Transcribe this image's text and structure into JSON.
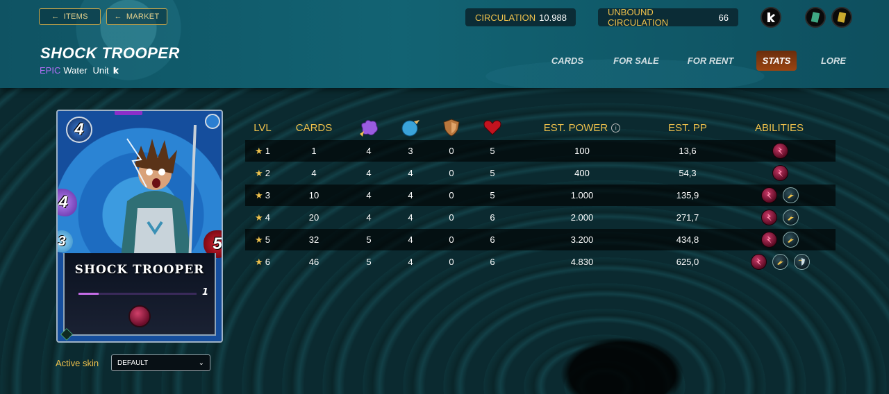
{
  "nav": {
    "items_label": "ITEMS",
    "market_label": "MARKET"
  },
  "stats_bar": {
    "circulation_label": "CIRCULATION",
    "circulation_value": "10.988",
    "unbound_label": "UNBOUND CIRCULATION",
    "unbound_value": "66"
  },
  "card_header": {
    "name": "SHOCK TROOPER",
    "rarity": "EPIC",
    "element": "Water",
    "type": "Unit"
  },
  "tabs": [
    {
      "label": "CARDS",
      "active": false
    },
    {
      "label": "FOR SALE",
      "active": false
    },
    {
      "label": "FOR RENT",
      "active": false
    },
    {
      "label": "STATS",
      "active": true
    },
    {
      "label": "LORE",
      "active": false
    }
  ],
  "card_art": {
    "mana": "4",
    "magic": "4",
    "speed": "3",
    "health": "5",
    "name": "SHOCK TROOPER",
    "level": "1",
    "level_progress": 0.17
  },
  "skin": {
    "label": "Active skin",
    "selected": "DEFAULT"
  },
  "table": {
    "headers": {
      "lvl": "LVL",
      "cards": "CARDS",
      "est_power": "EST. POWER",
      "est_pp": "EST. PP",
      "abilities": "ABILITIES"
    },
    "rows": [
      {
        "lvl": "1",
        "cards": "1",
        "magic": "4",
        "speed": "3",
        "armor": "0",
        "health": "5",
        "power": "100",
        "pp": "13,6",
        "abilities": [
          "shock-icon"
        ]
      },
      {
        "lvl": "2",
        "cards": "4",
        "magic": "4",
        "speed": "4",
        "armor": "0",
        "health": "5",
        "power": "400",
        "pp": "54,3",
        "abilities": [
          "shock-icon"
        ]
      },
      {
        "lvl": "3",
        "cards": "10",
        "magic": "4",
        "speed": "4",
        "armor": "0",
        "health": "5",
        "power": "1.000",
        "pp": "135,9",
        "abilities": [
          "shock-icon",
          "swiftness-icon"
        ]
      },
      {
        "lvl": "4",
        "cards": "20",
        "magic": "4",
        "speed": "4",
        "armor": "0",
        "health": "6",
        "power": "2.000",
        "pp": "271,7",
        "abilities": [
          "shock-icon",
          "swiftness-icon"
        ]
      },
      {
        "lvl": "5",
        "cards": "32",
        "magic": "5",
        "speed": "4",
        "armor": "0",
        "health": "6",
        "power": "3.200",
        "pp": "434,8",
        "abilities": [
          "shock-icon",
          "swiftness-icon"
        ]
      },
      {
        "lvl": "6",
        "cards": "46",
        "magic": "5",
        "speed": "4",
        "armor": "0",
        "health": "6",
        "power": "4.830",
        "pp": "625,0",
        "abilities": [
          "shock-icon",
          "swiftness-icon",
          "shield-icon"
        ]
      }
    ]
  },
  "colors": {
    "gold": "#f0c24c",
    "epic_purple": "#b06ff5",
    "active_tab": "#9a4512"
  }
}
